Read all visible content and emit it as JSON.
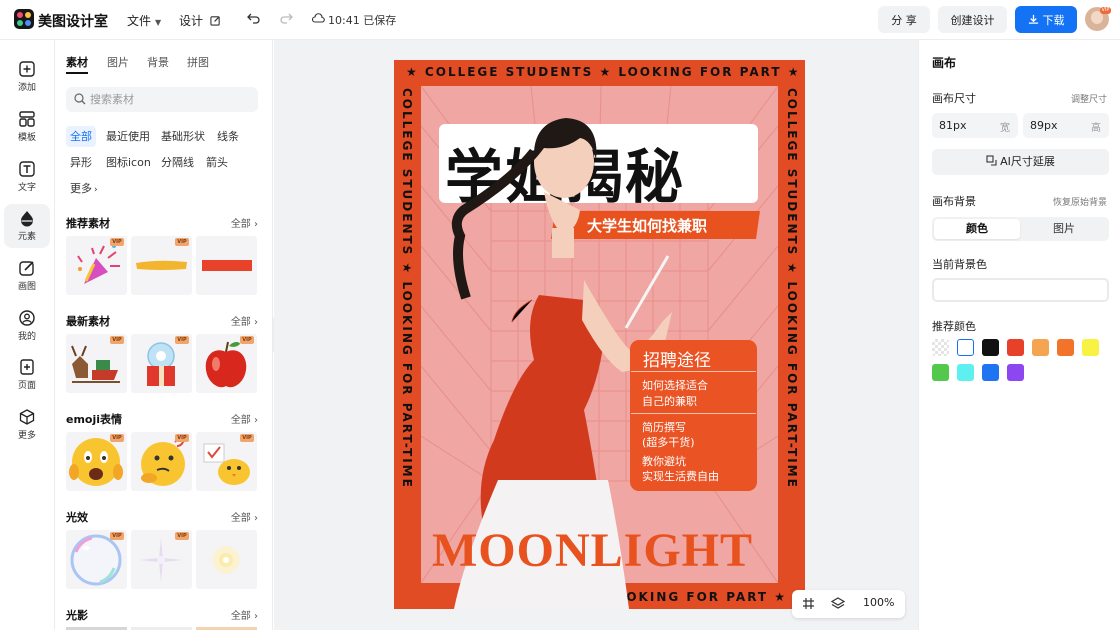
{
  "app": {
    "name": "美图设计室"
  },
  "topbar": {
    "menu_file": "文件",
    "menu_design": "设计",
    "saved_status": "10:41 已保存",
    "share_label": "分 享",
    "create_label": "创建设计",
    "download_label": "下载",
    "vip_badge": "VIP"
  },
  "rail": {
    "items": [
      {
        "label": "添加",
        "icon": "plus-square-icon"
      },
      {
        "label": "模板",
        "icon": "template-icon"
      },
      {
        "label": "文字",
        "icon": "text-icon"
      },
      {
        "label": "元素",
        "icon": "element-icon"
      },
      {
        "label": "画图",
        "icon": "draw-icon"
      },
      {
        "label": "我的",
        "icon": "user-icon"
      },
      {
        "label": "页面",
        "icon": "page-icon"
      },
      {
        "label": "更多",
        "icon": "cube-icon"
      }
    ]
  },
  "panel": {
    "tabs": [
      "素材",
      "图片",
      "背景",
      "拼图"
    ],
    "search_placeholder": "搜索素材",
    "chips": [
      "全部",
      "最近使用",
      "基础形状",
      "线条",
      "异形",
      "图标icon",
      "分隔线",
      "箭头",
      "更多"
    ],
    "vip_label": "VIP",
    "all_label": "全部",
    "sections": [
      {
        "title": "推荐素材"
      },
      {
        "title": "最新素材"
      },
      {
        "title": "emoji表情"
      },
      {
        "title": "光效"
      },
      {
        "title": "光影"
      }
    ]
  },
  "poster": {
    "ribbon_top": "★ COLLEGE STUDENTS ★ LOOKING FOR PART ★",
    "ribbon_bottom": "★ LOOKING FOR PART ★",
    "ribbon_left": "COLLEGE STUDENTS ★ LOOKING FOR PART-TIME",
    "ribbon_right": "COLLEGE STUDENTS ★ LOOKING FOR PART-TIME",
    "title": "学姐揭秘",
    "subtitle": "大学生如何找兼职",
    "info_title": "招聘途径",
    "info_1a": "如何选择适合",
    "info_1b": "自己的兼职",
    "info_2a": "简历撰写",
    "info_2b": "(超多干货)",
    "info_3a": "教你避坑",
    "info_3b": "实现生活费自由",
    "footer_word": "MOONLIGHT"
  },
  "canvas_tools": {
    "zoom": "100%"
  },
  "inspector": {
    "title": "画布",
    "size_label": "画布尺寸",
    "adjust_label": "调整尺寸",
    "width_value": "81px",
    "width_unit": "宽",
    "height_value": "89px",
    "height_unit": "高",
    "ai_label": "AI尺寸延展",
    "bg_label": "画布背景",
    "restore_label": "恢复原始背景",
    "seg_color": "颜色",
    "seg_image": "图片",
    "current_bg_label": "当前背景色",
    "recommend_label": "推荐颜色",
    "swatches": [
      "transparent",
      "#ffffff",
      "#111111",
      "#e8412a",
      "#f5a552",
      "#f27329",
      "#f7f243",
      "#54c84a",
      "#5ef0f0",
      "#1f74f2",
      "#8d47f0"
    ]
  }
}
